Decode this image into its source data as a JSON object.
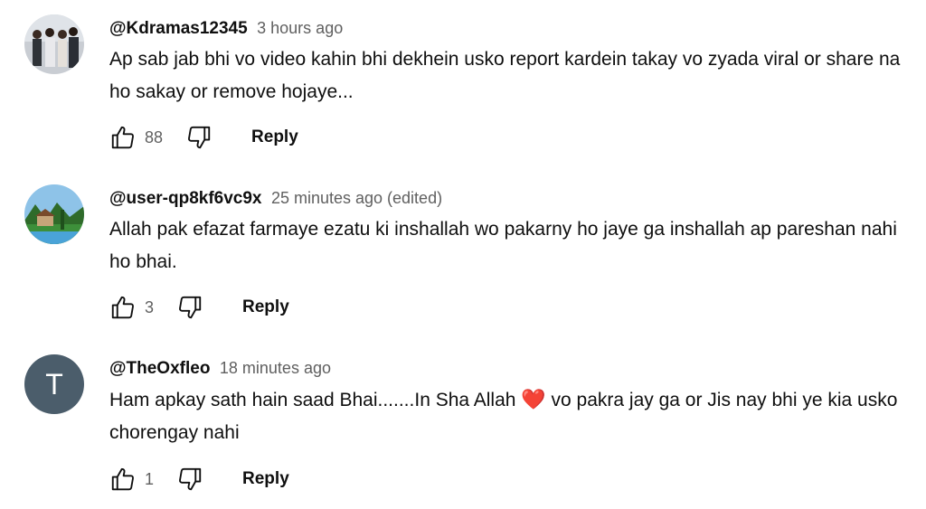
{
  "comments": [
    {
      "handle": "@Kdramas12345",
      "time": "3 hours ago",
      "text": "Ap sab jab bhi vo video kahin bhi dekhein usko report kardein takay vo zyada viral or share na ho sakay or remove hojaye...",
      "likes": "88",
      "reply_label": "Reply",
      "avatar_type": "photo-people"
    },
    {
      "handle": "@user-qp8kf6vc9x",
      "time": "25 minutes ago (edited)",
      "text": "Allah pak efazat farmaye ezatu ki inshallah wo pakarny ho jaye ga inshallah ap pareshan nahi ho bhai.",
      "likes": "3",
      "reply_label": "Reply",
      "avatar_type": "photo-landscape"
    },
    {
      "handle": "@TheOxfleo",
      "time": "18 minutes ago",
      "text_before": "Ham apkay sath hain saad Bhai.......In Sha Allah",
      "emoji": "❤️",
      "text_after": "vo pakra jay ga or Jis nay bhi ye kia usko chorengay nahi",
      "likes": "1",
      "reply_label": "Reply",
      "avatar_letter": "T",
      "avatar_color": "#4b5d6b"
    }
  ],
  "icons": {
    "like": "thumbs-up-icon",
    "dislike": "thumbs-down-icon"
  }
}
